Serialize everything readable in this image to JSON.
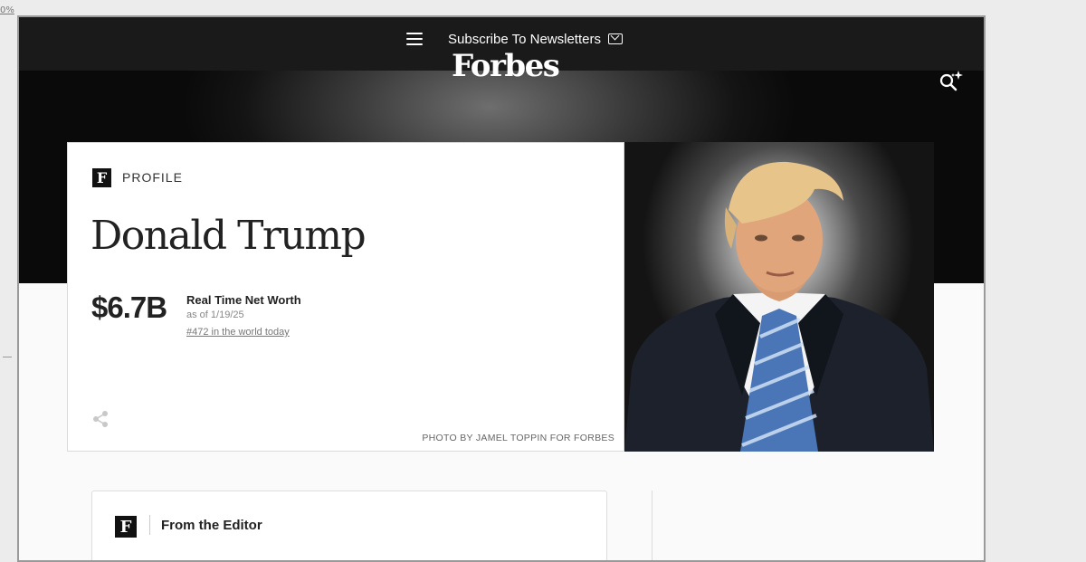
{
  "edge": {
    "zoom_fragment": "0%"
  },
  "nav": {
    "menu_icon": "hamburger-menu-icon",
    "subscribe_label": "Subscribe To Newsletters",
    "subscribe_icon": "mail-icon",
    "logo": "Forbes",
    "search_icon": "ai-search-icon"
  },
  "profile": {
    "badge": "F",
    "section_label": "PROFILE",
    "name": "Donald Trump",
    "net_worth": "$6.7B",
    "net_worth_label": "Real Time Net Worth",
    "as_of": "as of 1/19/25",
    "rank": "#472 in the world today",
    "share_icon": "share-icon",
    "photo_credit": "PHOTO BY JAMEL TOPPIN FOR FORBES"
  },
  "editor": {
    "badge": "F",
    "title": "From the Editor"
  },
  "colors": {
    "nav_bg": "#1a1a1a",
    "card_bg": "#ffffff",
    "text": "#222222",
    "tie_blue": "#4a76b8"
  }
}
